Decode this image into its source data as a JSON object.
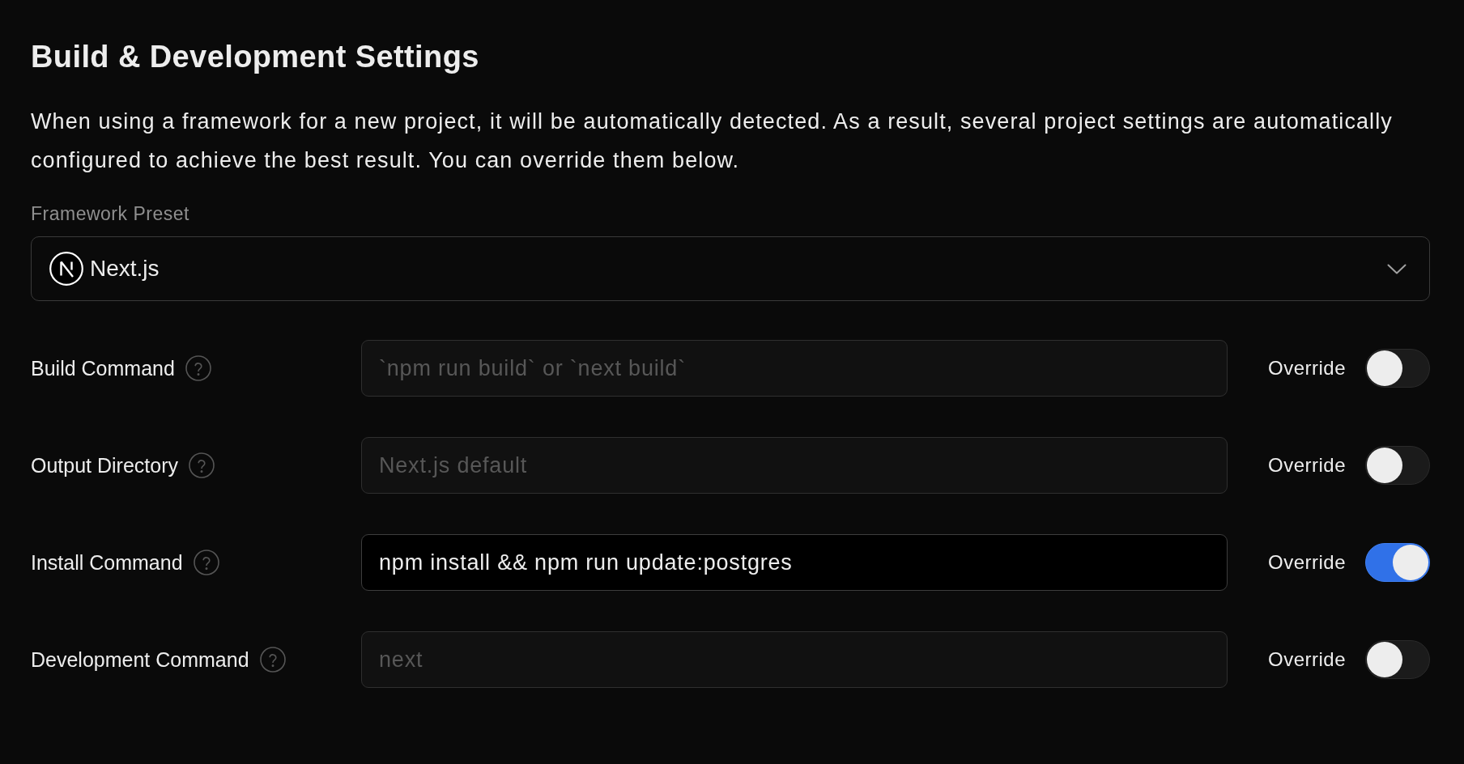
{
  "section": {
    "title": "Build & Development Settings",
    "description": "When using a framework for a new project, it will be automatically detected. As a result, several project settings are automatically configured to achieve the best result. You can override them below."
  },
  "framework_preset": {
    "label": "Framework Preset",
    "value": "Next.js"
  },
  "fields": [
    {
      "label": "Build Command",
      "placeholder": "`npm run build` or `next build`",
      "override_label": "Override",
      "override": false
    },
    {
      "label": "Output Directory",
      "placeholder": "Next.js default",
      "override_label": "Override",
      "override": false
    },
    {
      "label": "Install Command",
      "value": "npm install && npm run update:postgres",
      "override_label": "Override",
      "override": true
    },
    {
      "label": "Development Command",
      "placeholder": "next",
      "override_label": "Override",
      "override": false
    }
  ]
}
